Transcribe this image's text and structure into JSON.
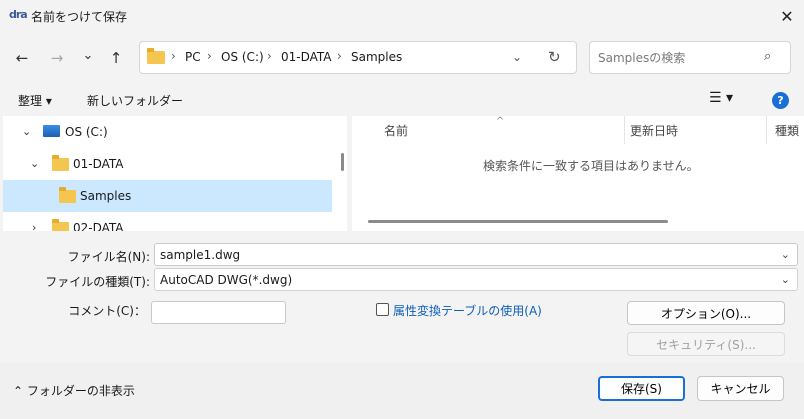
{
  "window": {
    "title": "名前をつけて保存",
    "app_logo": "dra"
  },
  "nav": {
    "back_icon": "←",
    "forward_icon": "→",
    "recent_icon": "⌄",
    "up_icon": "↑"
  },
  "address": {
    "crumbs": [
      "PC",
      "OS (C:)",
      "01-DATA",
      "Samples"
    ],
    "sep": "›"
  },
  "search": {
    "placeholder": "Samplesの検索",
    "icon": "⌕"
  },
  "toolbar": {
    "organize": "整理 ▾",
    "new_folder": "新しいフォルダー",
    "view_icon": "☰ ▾",
    "help": "?"
  },
  "tree": {
    "items": [
      {
        "label": "OS (C:)"
      },
      {
        "label": "01-DATA"
      },
      {
        "label": "Samples"
      },
      {
        "label": "02-DATA"
      }
    ]
  },
  "list": {
    "columns": [
      "名前",
      "更新日時",
      "種類"
    ],
    "empty_message": "検索条件に一致する項目はありません。"
  },
  "form": {
    "filename_label": "ファイル名(N):",
    "filename_value": "sample1.dwg",
    "filetype_label": "ファイルの種類(T):",
    "filetype_value": "AutoCAD DWG(*.dwg)",
    "comment_label": "コメント(C)：",
    "attr_checkbox_label": "属性変換テーブルの使用(A)",
    "options_button": "オプション(O)...",
    "security_button": "セキュリティ(S)..."
  },
  "footer": {
    "hide_folders": "⌃ フォルダーの非表示",
    "save_button": "保存(S)",
    "cancel_button": "キャンセル"
  },
  "colors": {
    "accent": "#1a6fd6",
    "selected_row": "#cce8ff",
    "link": "#0e5fb8",
    "folder": "#f4c64f"
  }
}
